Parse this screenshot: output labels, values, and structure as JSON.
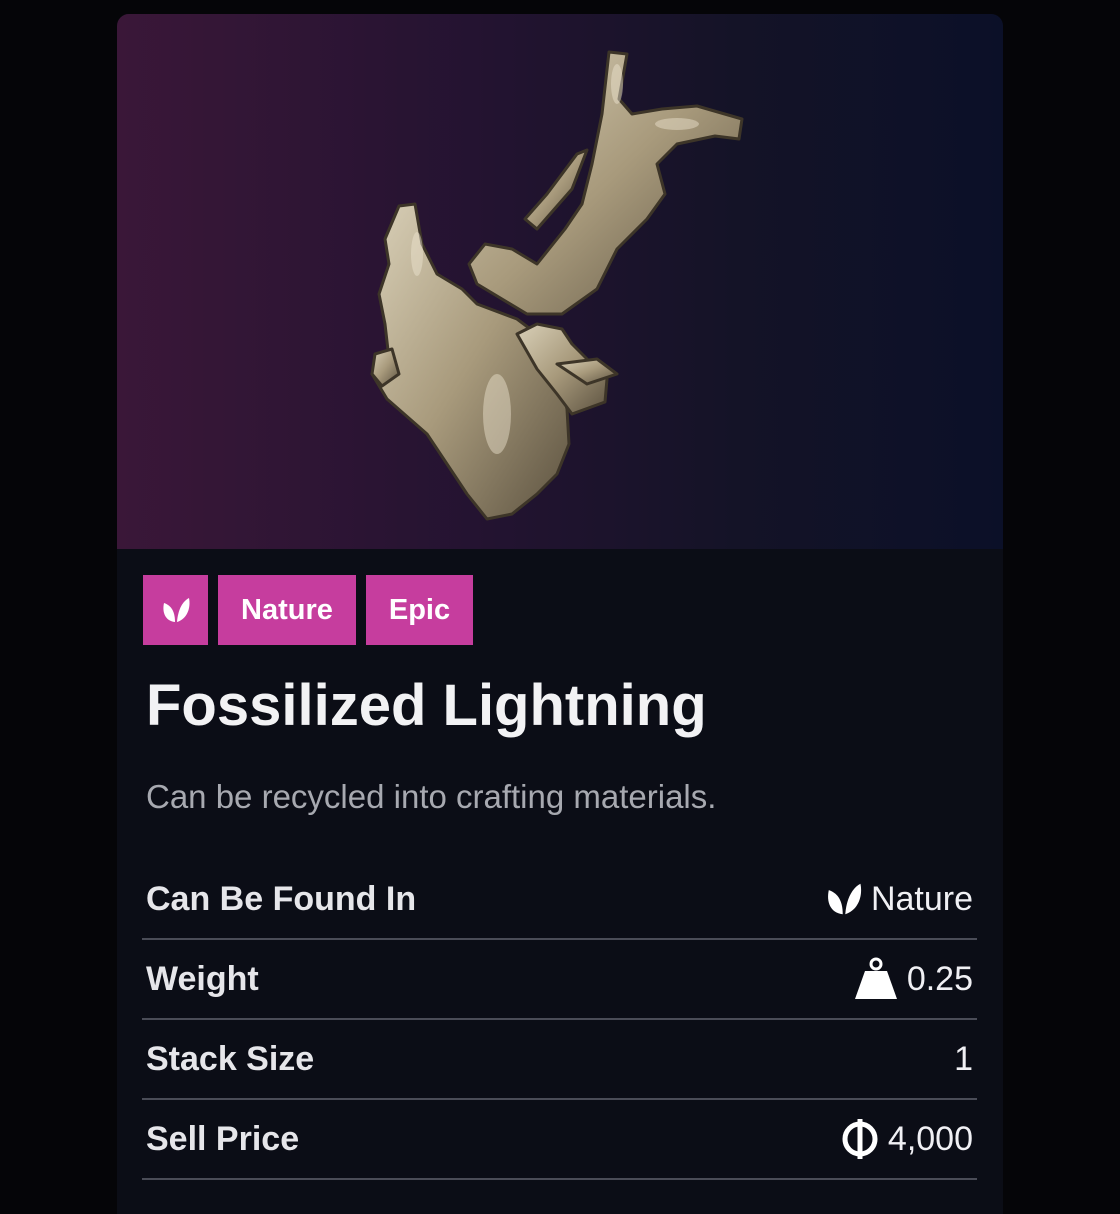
{
  "item": {
    "name": "Fossilized Lightning",
    "description": "Can be recycled into crafting materials.",
    "image_icon": "fossilized-lightning-image"
  },
  "tags": {
    "type_icon": "leaf-icon",
    "category": "Nature",
    "rarity": "Epic"
  },
  "stats": {
    "found_in": {
      "label": "Can Be Found In",
      "value": "Nature",
      "icon": "leaf-icon"
    },
    "weight": {
      "label": "Weight",
      "value": "0.25",
      "icon": "weight-icon"
    },
    "stack_size": {
      "label": "Stack Size",
      "value": "1"
    },
    "sell_price": {
      "label": "Sell Price",
      "value": "4,000",
      "icon": "coin-icon"
    }
  },
  "colors": {
    "tag": "#c63d9e",
    "card": "#0b0d16"
  }
}
